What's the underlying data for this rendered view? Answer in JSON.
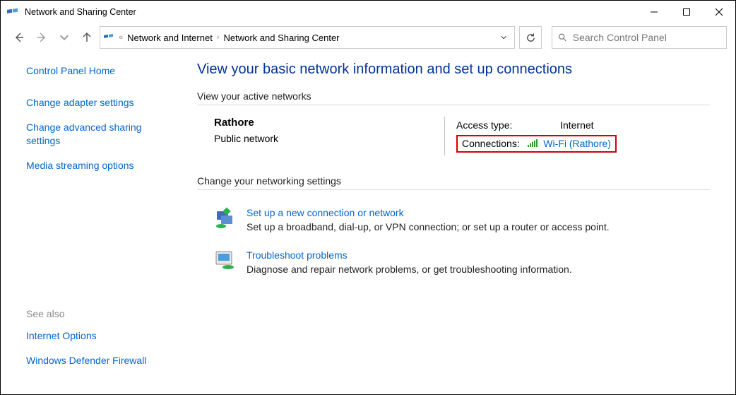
{
  "window": {
    "title": "Network and Sharing Center"
  },
  "breadcrumb": {
    "prefix": "«",
    "item1": "Network and Internet",
    "item2": "Network and Sharing Center"
  },
  "search": {
    "placeholder": "Search Control Panel"
  },
  "sidebar": {
    "home": "Control Panel Home",
    "adapter": "Change adapter settings",
    "advanced": "Change advanced sharing settings",
    "media": "Media streaming options"
  },
  "see_also": {
    "title": "See also",
    "internet_options": "Internet Options",
    "firewall": "Windows Defender Firewall"
  },
  "main": {
    "heading": "View your basic network information and set up connections",
    "active_label": "View your active networks",
    "network": {
      "name": "Rathore",
      "type": "Public network",
      "access_label": "Access type:",
      "access_value": "Internet",
      "connections_label": "Connections:",
      "connection_link": "Wi-Fi (Rathore)"
    },
    "change_label": "Change your networking settings",
    "setup": {
      "title": "Set up a new connection or network",
      "desc": "Set up a broadband, dial-up, or VPN connection; or set up a router or access point."
    },
    "troubleshoot": {
      "title": "Troubleshoot problems",
      "desc": "Diagnose and repair network problems, or get troubleshooting information."
    }
  }
}
